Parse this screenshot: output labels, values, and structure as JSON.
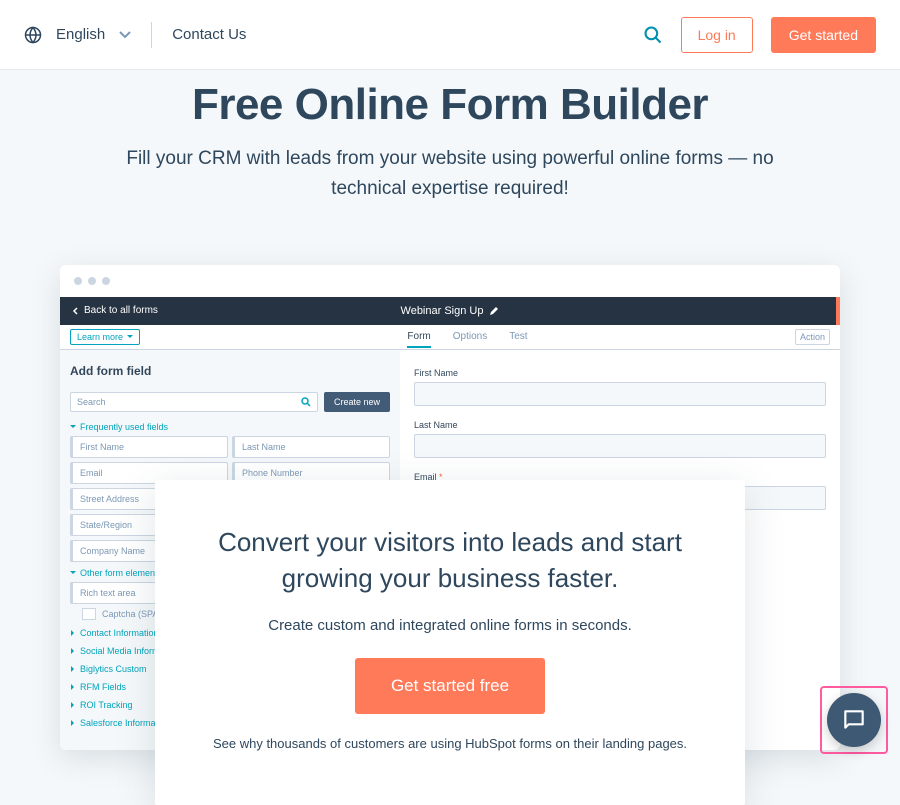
{
  "nav": {
    "language": "English",
    "contact": "Contact Us",
    "login": "Log in",
    "get_started": "Get started"
  },
  "hero": {
    "title": "Free Online Form Builder",
    "subtitle": "Fill your CRM with leads from your website using powerful online forms — no technical expertise required!"
  },
  "app": {
    "back": "Back to all forms",
    "title": "Webinar Sign Up",
    "learn_more": "Learn more",
    "tabs": {
      "form": "Form",
      "options": "Options",
      "test": "Test"
    },
    "action": "Action",
    "left": {
      "heading": "Add form field",
      "search_placeholder": "Search",
      "create_new": "Create new",
      "group_freq": "Frequently used fields",
      "fields": {
        "first_name": "First Name",
        "last_name": "Last Name",
        "email": "Email",
        "phone": "Phone Number",
        "street": "Street Address",
        "state": "State/Region",
        "company": "Company Name"
      },
      "group_other": "Other form elements",
      "rich_text": "Rich text area",
      "captcha": "Captcha (SPA",
      "categories": {
        "contact": "Contact Information",
        "social": "Social Media Information",
        "biglytics": "Biglytics Custom",
        "rfm": "RFM Fields",
        "roi": "ROI Tracking",
        "salesforce": "Salesforce Information"
      }
    },
    "right": {
      "first_name": "First Name",
      "last_name": "Last Name",
      "email": "Email"
    }
  },
  "card": {
    "heading": "Convert your visitors into leads and start growing your business faster.",
    "sub1": "Create custom and integrated online forms in seconds.",
    "cta": "Get started free",
    "sub2": "See why thousands of customers are using HubSpot forms on their landing pages."
  }
}
